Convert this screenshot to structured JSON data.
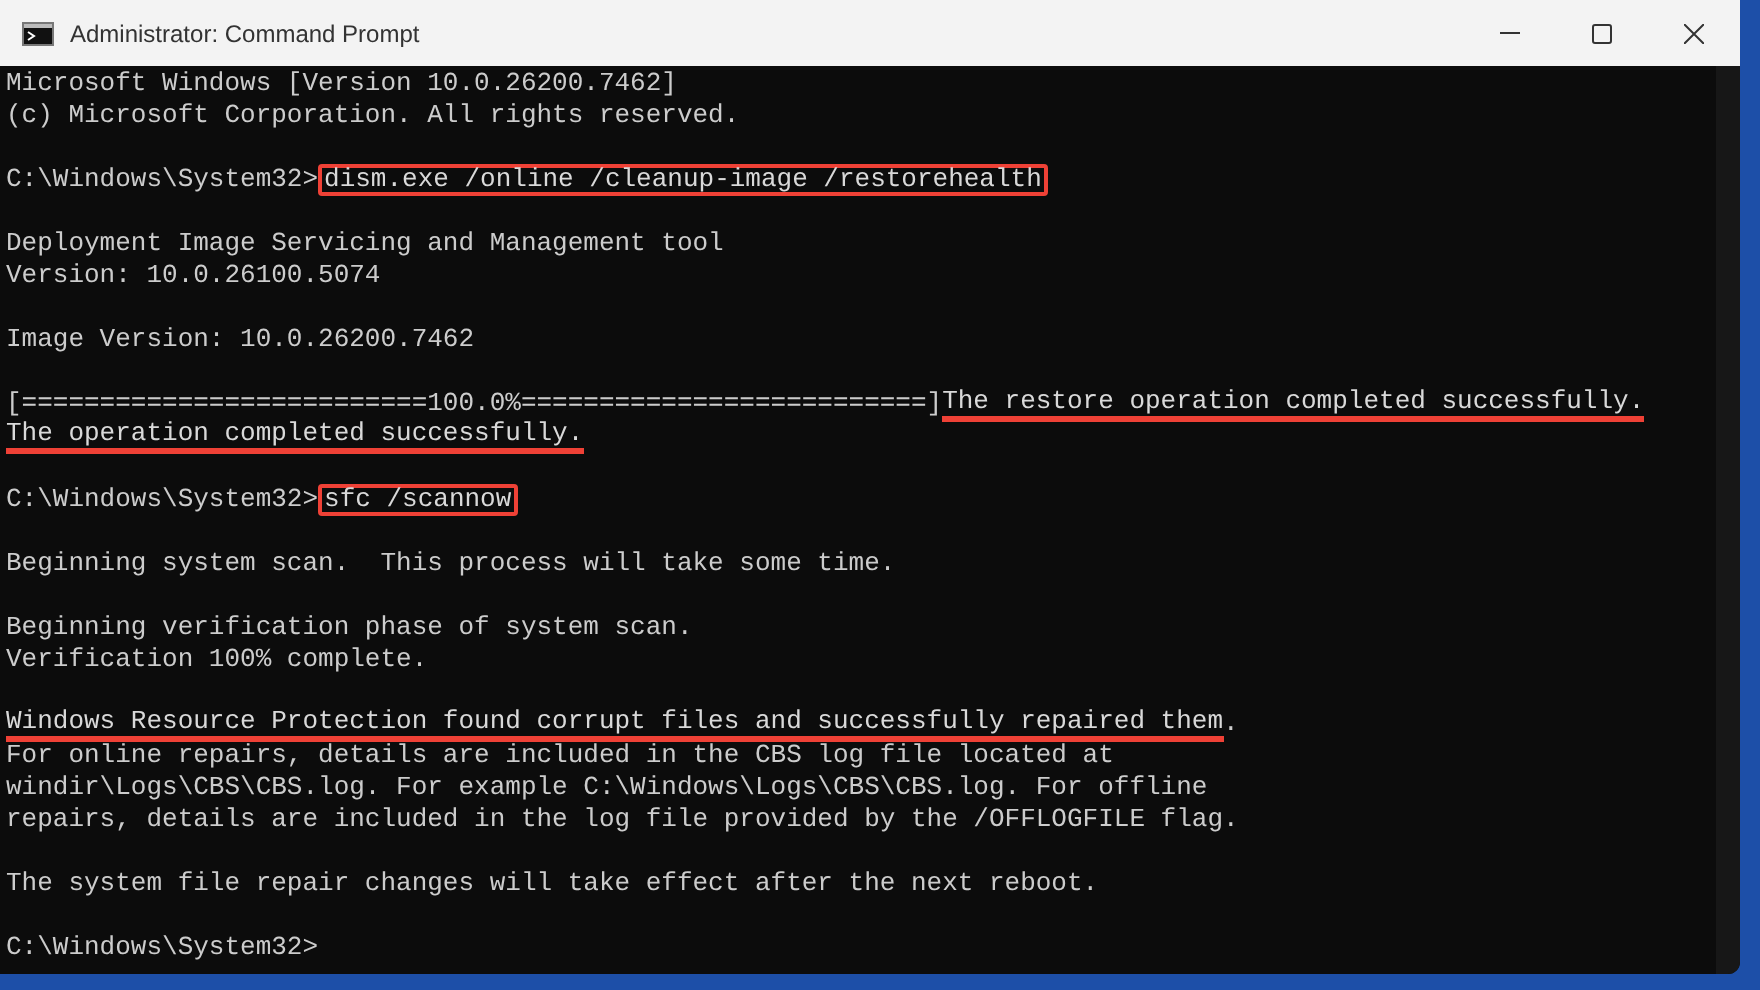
{
  "window": {
    "title": "Administrator: Command Prompt"
  },
  "console": {
    "lines": [
      {
        "kind": "text",
        "segments": [
          {
            "text": "Microsoft Windows [Version 10.0.26200.7462]",
            "kind": "plain"
          }
        ]
      },
      {
        "kind": "text",
        "segments": [
          {
            "text": "(c) Microsoft Corporation. All rights reserved.",
            "kind": "plain"
          }
        ]
      },
      {
        "kind": "blank"
      },
      {
        "kind": "text",
        "segments": [
          {
            "text": "C:\\Windows\\System32>",
            "kind": "plain"
          },
          {
            "text": "dism.exe /online /cleanup-image /restorehealth",
            "kind": "boxed"
          }
        ]
      },
      {
        "kind": "blank"
      },
      {
        "kind": "text",
        "segments": [
          {
            "text": "Deployment Image Servicing and Management tool",
            "kind": "plain"
          }
        ]
      },
      {
        "kind": "text",
        "segments": [
          {
            "text": "Version: 10.0.26100.5074",
            "kind": "plain"
          }
        ]
      },
      {
        "kind": "blank"
      },
      {
        "kind": "text",
        "segments": [
          {
            "text": "Image Version: 10.0.26200.7462",
            "kind": "plain"
          }
        ]
      },
      {
        "kind": "blank"
      },
      {
        "kind": "text",
        "segments": [
          {
            "text": "[==========================100.0%==========================]",
            "kind": "plain"
          },
          {
            "text": "The restore operation completed successfully.",
            "kind": "underlined"
          }
        ]
      },
      {
        "kind": "text",
        "segments": [
          {
            "text": "The operation completed successfully.",
            "kind": "underlined"
          }
        ]
      },
      {
        "kind": "blank"
      },
      {
        "kind": "text",
        "segments": [
          {
            "text": "C:\\Windows\\System32>",
            "kind": "plain"
          },
          {
            "text": "sfc /scannow",
            "kind": "boxed"
          }
        ]
      },
      {
        "kind": "blank"
      },
      {
        "kind": "text",
        "segments": [
          {
            "text": "Beginning system scan.  This process will take some time.",
            "kind": "plain"
          }
        ]
      },
      {
        "kind": "blank"
      },
      {
        "kind": "text",
        "segments": [
          {
            "text": "Beginning verification phase of system scan.",
            "kind": "plain"
          }
        ]
      },
      {
        "kind": "text",
        "segments": [
          {
            "text": "Verification 100% complete.",
            "kind": "plain"
          }
        ]
      },
      {
        "kind": "blank"
      },
      {
        "kind": "text",
        "segments": [
          {
            "text": "Windows Resource Protection found corrupt files and successfully repaired them",
            "kind": "underlined"
          },
          {
            "text": ".",
            "kind": "plain"
          }
        ]
      },
      {
        "kind": "text",
        "segments": [
          {
            "text": "For online repairs, details are included in the CBS log file located at",
            "kind": "plain"
          }
        ]
      },
      {
        "kind": "text",
        "segments": [
          {
            "text": "windir\\Logs\\CBS\\CBS.log. For example C:\\Windows\\Logs\\CBS\\CBS.log. For offline",
            "kind": "plain"
          }
        ]
      },
      {
        "kind": "text",
        "segments": [
          {
            "text": "repairs, details are included in the log file provided by the /OFFLOGFILE flag.",
            "kind": "plain"
          }
        ]
      },
      {
        "kind": "blank"
      },
      {
        "kind": "text",
        "segments": [
          {
            "text": "The system file repair changes will take effect after the next reboot.",
            "kind": "plain"
          }
        ]
      },
      {
        "kind": "blank"
      },
      {
        "kind": "text",
        "segments": [
          {
            "text": "C:\\Windows\\System32>",
            "kind": "plain"
          }
        ]
      }
    ]
  }
}
